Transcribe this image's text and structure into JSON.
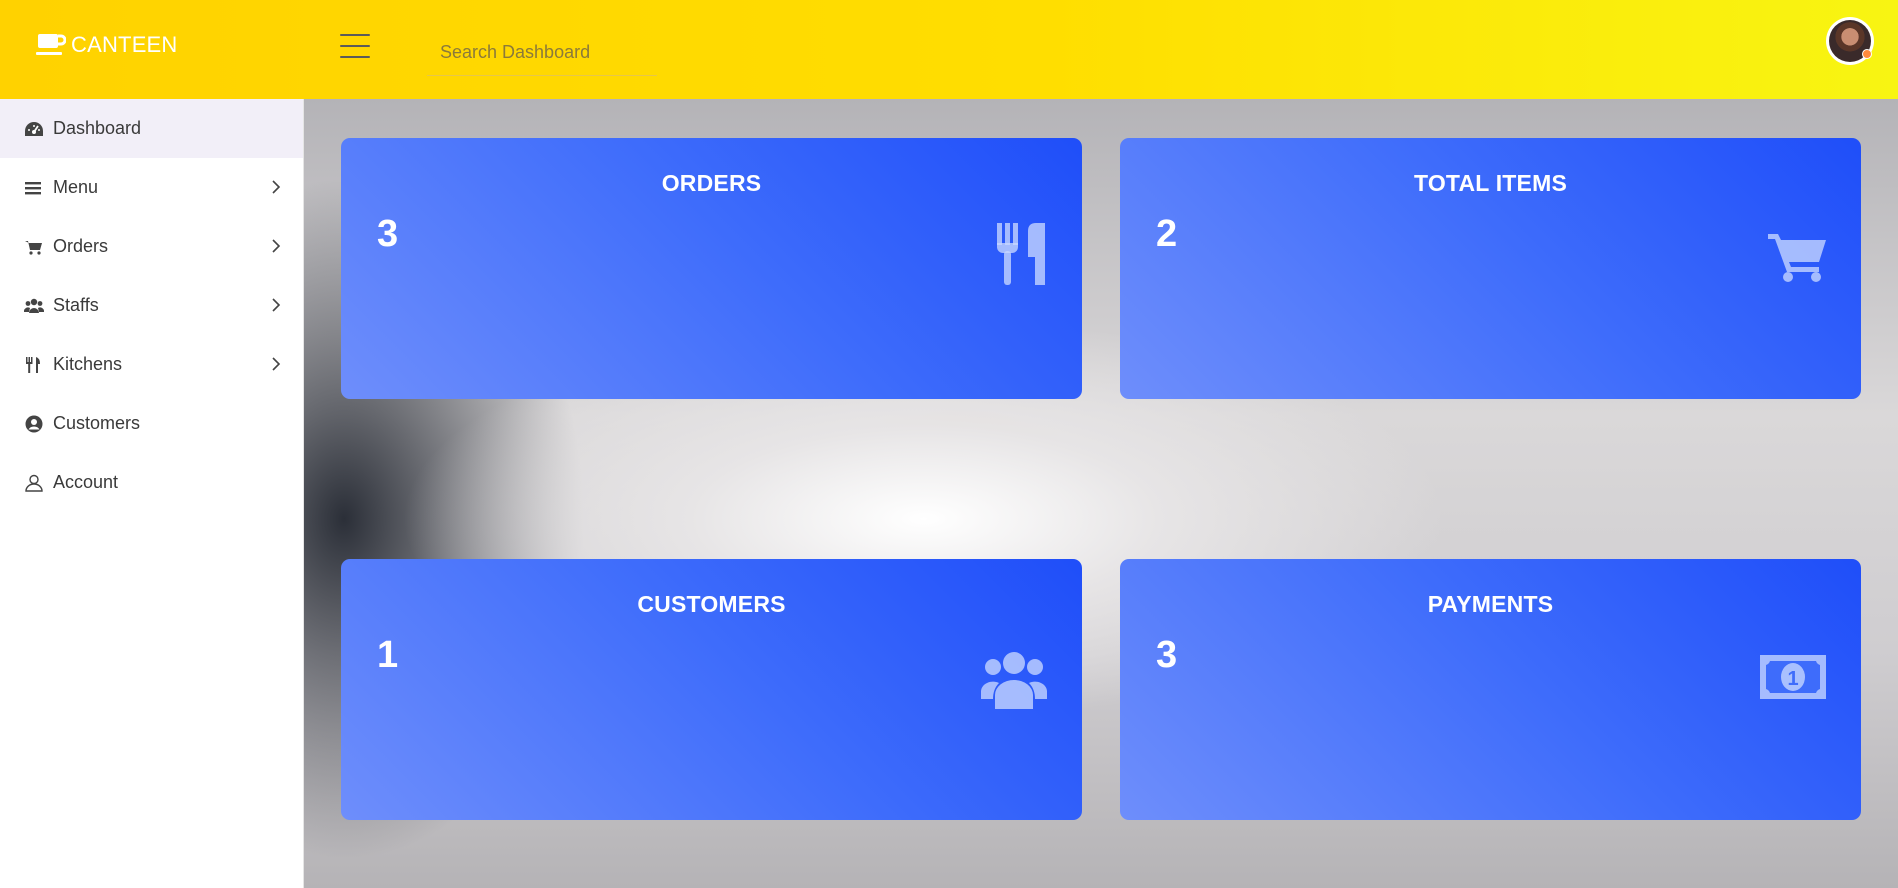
{
  "brand": {
    "name": "CANTEEN",
    "icon": "cup-icon"
  },
  "header": {
    "menu_icon": "hamburger-icon",
    "search_placeholder": "Search Dashboard",
    "avatar": "user-avatar"
  },
  "sidebar": {
    "items": [
      {
        "label": "Dashboard",
        "icon": "tachometer-icon",
        "active": true,
        "has_submenu": false
      },
      {
        "label": "Menu",
        "icon": "bars-icon",
        "active": false,
        "has_submenu": true
      },
      {
        "label": "Orders",
        "icon": "cart-icon",
        "active": false,
        "has_submenu": true
      },
      {
        "label": "Staffs",
        "icon": "users-icon",
        "active": false,
        "has_submenu": true
      },
      {
        "label": "Kitchens",
        "icon": "utensils-icon",
        "active": false,
        "has_submenu": true
      },
      {
        "label": "Customers",
        "icon": "user-circle-icon",
        "active": false,
        "has_submenu": false
      },
      {
        "label": "Account",
        "icon": "user-outline-icon",
        "active": false,
        "has_submenu": false
      }
    ]
  },
  "cards": [
    {
      "title": "ORDERS",
      "value": "3",
      "icon": "utensils-icon"
    },
    {
      "title": "TOTAL ITEMS",
      "value": "2",
      "icon": "cart-icon"
    },
    {
      "title": "CUSTOMERS",
      "value": "1",
      "icon": "users-icon"
    },
    {
      "title": "PAYMENTS",
      "value": "3",
      "icon": "money-bill-icon"
    }
  ],
  "colors": {
    "header_start": "#ffd200",
    "header_end": "#f8f512",
    "card_start": "#1f4ef9",
    "card_end": "#6e8efb",
    "sidebar_active": "#f2eff8"
  }
}
